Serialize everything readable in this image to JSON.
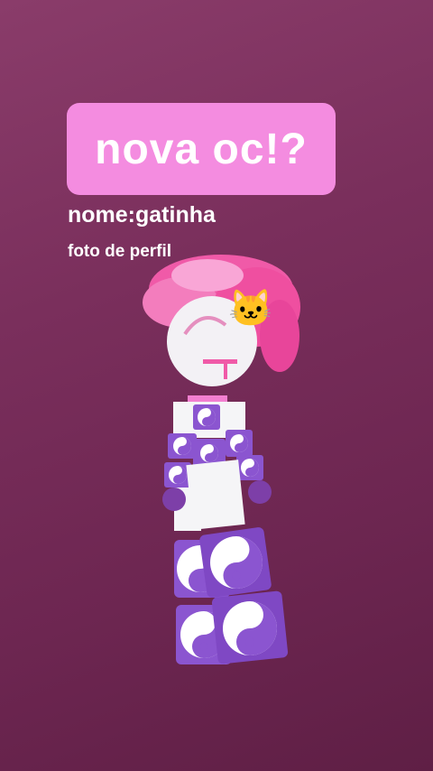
{
  "story": {
    "title": "nova oc!?",
    "name_line": "nome:gatinha",
    "profile_line": "foto de perfil",
    "title_box_color": "#f48ce0",
    "cat_emoji": "🐱"
  },
  "avatar": {
    "hair_color": "#f05aa8",
    "head_color": "#f3f1f5",
    "outfit_primary": "#8b55d0",
    "outfit_light": "#f5f5f7",
    "icon": "yin-yang-icon"
  }
}
